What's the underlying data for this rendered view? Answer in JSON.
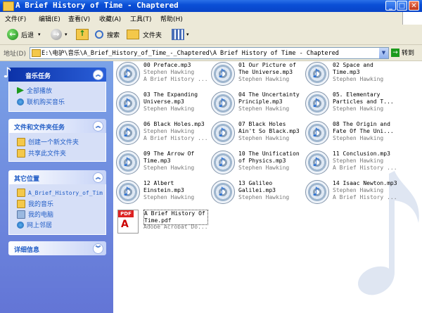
{
  "window": {
    "title": "A Brief History of Time - Chaptered"
  },
  "menu": [
    "文件(F)",
    "编辑(E)",
    "查看(V)",
    "收藏(A)",
    "工具(T)",
    "帮助(H)"
  ],
  "toolbar": {
    "back": "后退",
    "search": "搜索",
    "folders": "文件夹"
  },
  "address": {
    "label": "地址(D)",
    "path": "E:\\电驴\\音乐\\A_Brief_History_of_Time_-_Chaptered\\A Brief History of Time - Chaptered",
    "go": "转到"
  },
  "sidebar": {
    "music_tasks": {
      "title": "音乐任务",
      "items": [
        "全部播放",
        "联机购买音乐"
      ]
    },
    "file_tasks": {
      "title": "文件和文件夹任务",
      "items": [
        "创建一个新文件夹",
        "共享此文件夹"
      ]
    },
    "other_places": {
      "title": "其它位置",
      "items": [
        "A_Brief_History_of_Tim",
        "我的音乐",
        "我的电脑",
        "网上邻居"
      ]
    },
    "details": {
      "title": "详细信息"
    }
  },
  "files": [
    {
      "name": "00 Preface.mp3",
      "artist": "Stephen Hawking",
      "album": "A Brief History ..."
    },
    {
      "name": "01 Our Picture of\nThe Universe.mp3",
      "artist": "Stephen Hawking",
      "album": ""
    },
    {
      "name": "02 Space and\nTime.mp3",
      "artist": "Stephen Hawking",
      "album": ""
    },
    {
      "name": "03 The Expanding\nUniverse.mp3",
      "artist": "Stephen Hawking",
      "album": ""
    },
    {
      "name": "04 The Uncertainty\nPrinciple.mp3",
      "artist": "Stephen Hawking",
      "album": ""
    },
    {
      "name": "05. Elementary\nParticles and T...",
      "artist": "Stephen Hawking",
      "album": ""
    },
    {
      "name": "06 Black Holes.mp3",
      "artist": "Stephen Hawking",
      "album": "A Brief History ..."
    },
    {
      "name": "07 Black Holes\nAin't So Black.mp3",
      "artist": "Stephen Hawking",
      "album": ""
    },
    {
      "name": "08 The Origin and\nFate Of The Uni...",
      "artist": "Stephen Hawking",
      "album": ""
    },
    {
      "name": "09 The Arrow Of\nTime.mp3",
      "artist": "Stephen Hawking",
      "album": ""
    },
    {
      "name": "10 The Unification\nof Physics.mp3",
      "artist": "Stephen Hawking",
      "album": ""
    },
    {
      "name": "11 Conclusion.mp3",
      "artist": "Stephen Hawking",
      "album": "A Brief History ..."
    },
    {
      "name": "12 Albert\nEinstein.mp3",
      "artist": "Stephen Hawking",
      "album": ""
    },
    {
      "name": "13 Galileo\nGalilei.mp3",
      "artist": "Stephen Hawking",
      "album": ""
    },
    {
      "name": "14 Isaac Newton.mp3",
      "artist": "Stephen Hawking",
      "album": "A Brief History ..."
    },
    {
      "name": "A Brief History Of\nTime.pdf",
      "artist": "Adobe Acrobat Do...",
      "album": ""
    }
  ],
  "colors": {
    "accent": "#215dc6",
    "titlebar": "#0a4fd6"
  }
}
